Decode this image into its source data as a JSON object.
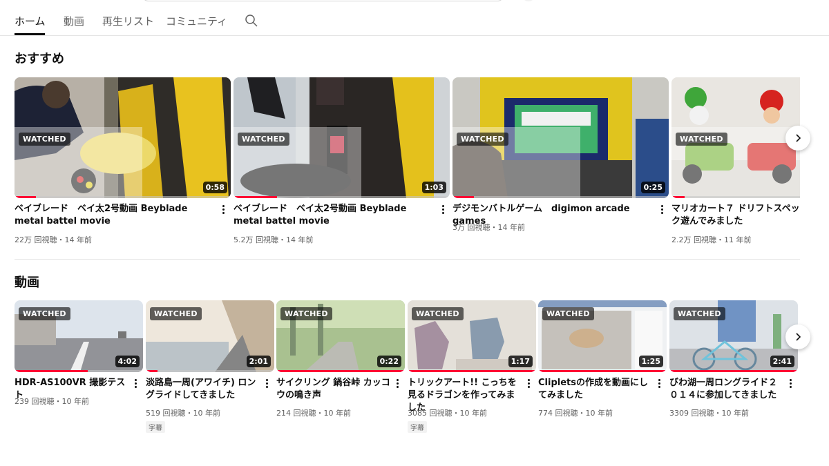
{
  "tabs": [
    {
      "label": "ホーム"
    },
    {
      "label": "動画"
    },
    {
      "label": "再生リスト"
    },
    {
      "label": "コミュニティ"
    }
  ],
  "accent_color": "#ff0033",
  "sections": {
    "recommended": {
      "title": "おすすめ",
      "videos": [
        {
          "title": "ベイブレード　ベイ太2号動画 Beyblade metal battel movie",
          "views": "22万 回視聴",
          "age": "14 年前",
          "duration": "0:58",
          "watched": "WATCHED",
          "progress": 0.1,
          "thumb_icon": "arcade-stadium-thumbnail"
        },
        {
          "title": "ベイブレード　ベイ太2号動画 Beyblade metal battel movie",
          "views": "5.2万 回視聴",
          "age": "14 年前",
          "duration": "1:03",
          "watched": "WATCHED",
          "progress": 0.2,
          "thumb_icon": "arcade-machine-thumbnail"
        },
        {
          "title": "デジモンバトルゲーム　digimon arcade games",
          "views": "3万 回視聴",
          "age": "14 年前",
          "duration": "0:25",
          "watched": "WATCHED",
          "progress": 0.1,
          "thumb_icon": "arcade-screen-thumbnail"
        },
        {
          "title": "マリオカート７ ドリフトスペック遊んでみました",
          "views": "2.2万 回視聴",
          "age": "11 年前",
          "duration": "",
          "watched": "WATCHED",
          "progress": 0.1,
          "thumb_icon": "toy-kart-thumbnail"
        }
      ]
    },
    "videos": {
      "title": "動画",
      "videos": [
        {
          "title": "HDR-AS100VR 撮影テスト",
          "views": "239 回視聴",
          "age": "10 年前",
          "duration": "4:02",
          "watched": "WATCHED",
          "progress": 0.57,
          "badge": ""
        },
        {
          "title": "淡路島一周(アワイチ) ロングライドしてきました",
          "views": "519 回視聴",
          "age": "10 年前",
          "duration": "2:01",
          "watched": "WATCHED",
          "progress": 0.09,
          "badge": "字幕"
        },
        {
          "title": "サイクリング 鍋谷峠 カッコウの鳴き声",
          "views": "214 回視聴",
          "age": "10 年前",
          "duration": "0:22",
          "watched": "WATCHED",
          "progress": 1.0,
          "badge": ""
        },
        {
          "title": "トリックアート!! こっちを見るドラゴンを作ってみました",
          "views": "3085 回視聴",
          "age": "10 年前",
          "duration": "1:17",
          "watched": "WATCHED",
          "progress": 1.0,
          "badge": "字幕"
        },
        {
          "title": "Clipletsの作成を動画にしてみました",
          "views": "774 回視聴",
          "age": "10 年前",
          "duration": "1:25",
          "watched": "WATCHED",
          "progress": 1.0,
          "badge": ""
        },
        {
          "title": "びわ湖一周ロングライド２０１４に参加してきました",
          "views": "3309 回視聴",
          "age": "10 年前",
          "duration": "2:41",
          "watched": "WATCHED",
          "progress": 1.0,
          "badge": ""
        }
      ]
    }
  }
}
